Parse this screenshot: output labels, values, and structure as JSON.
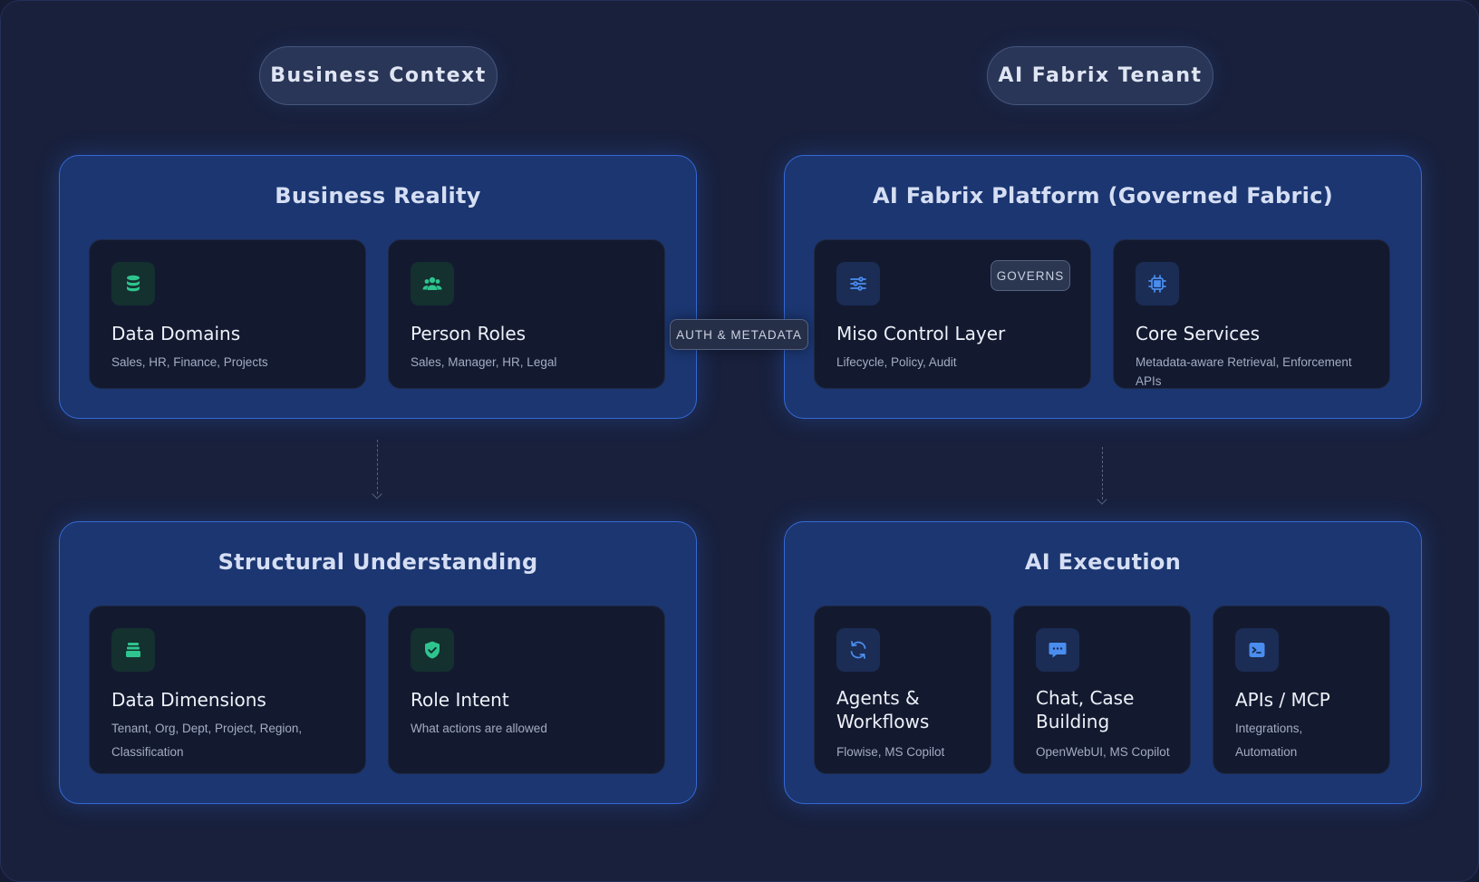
{
  "context_labels": {
    "left": "Business Context",
    "right": "AI Fabrix Tenant"
  },
  "panels": {
    "business_reality": {
      "title": "Business Reality",
      "cards": [
        {
          "icon": "database-icon",
          "title": "Data Domains",
          "sub": "Sales, HR, Finance, Projects"
        },
        {
          "icon": "users-icon",
          "title": "Person Roles",
          "sub": "Sales, Manager, HR, Legal"
        }
      ]
    },
    "platform": {
      "title": "AI Fabrix Platform (Governed Fabric)",
      "cards": [
        {
          "icon": "sliders-icon",
          "title": "Miso Control Layer",
          "sub": "Lifecycle, Policy, Audit",
          "badge": "GOVERNS"
        },
        {
          "icon": "chip-icon",
          "title": "Core Services",
          "sub": "Metadata-aware Retrieval, Enforcement APIs"
        }
      ]
    },
    "structural": {
      "title": "Structural Understanding",
      "cards": [
        {
          "icon": "layers-icon",
          "title": "Data Dimensions",
          "sub_line1": "Tenant, Org, Dept, Project, Region,",
          "sub_line2": "Classification"
        },
        {
          "icon": "shield-check-icon",
          "title": "Role Intent",
          "sub": "What actions are allowed"
        }
      ]
    },
    "execution": {
      "title": "AI Execution",
      "cards": [
        {
          "icon": "refresh-icon",
          "title_line1": "Agents &",
          "title_line2": "Workflows",
          "sub": "Flowise, MS Copilot"
        },
        {
          "icon": "chat-icon",
          "title_line1": "Chat, Case",
          "title_line2": "Building",
          "sub": "OpenWebUI, MS Copilot"
        },
        {
          "icon": "terminal-icon",
          "title": "APIs / MCP",
          "sub_line1": "Integrations,",
          "sub_line2": "Automation"
        }
      ]
    }
  },
  "bridge_label": "AUTH & METADATA",
  "colors": {
    "background": "#18203c",
    "panel": "#1b3671",
    "panel_border": "#3569d6",
    "card": "#131a30",
    "icon_green": "#2ec48e",
    "icon_blue": "#4a8dee"
  }
}
